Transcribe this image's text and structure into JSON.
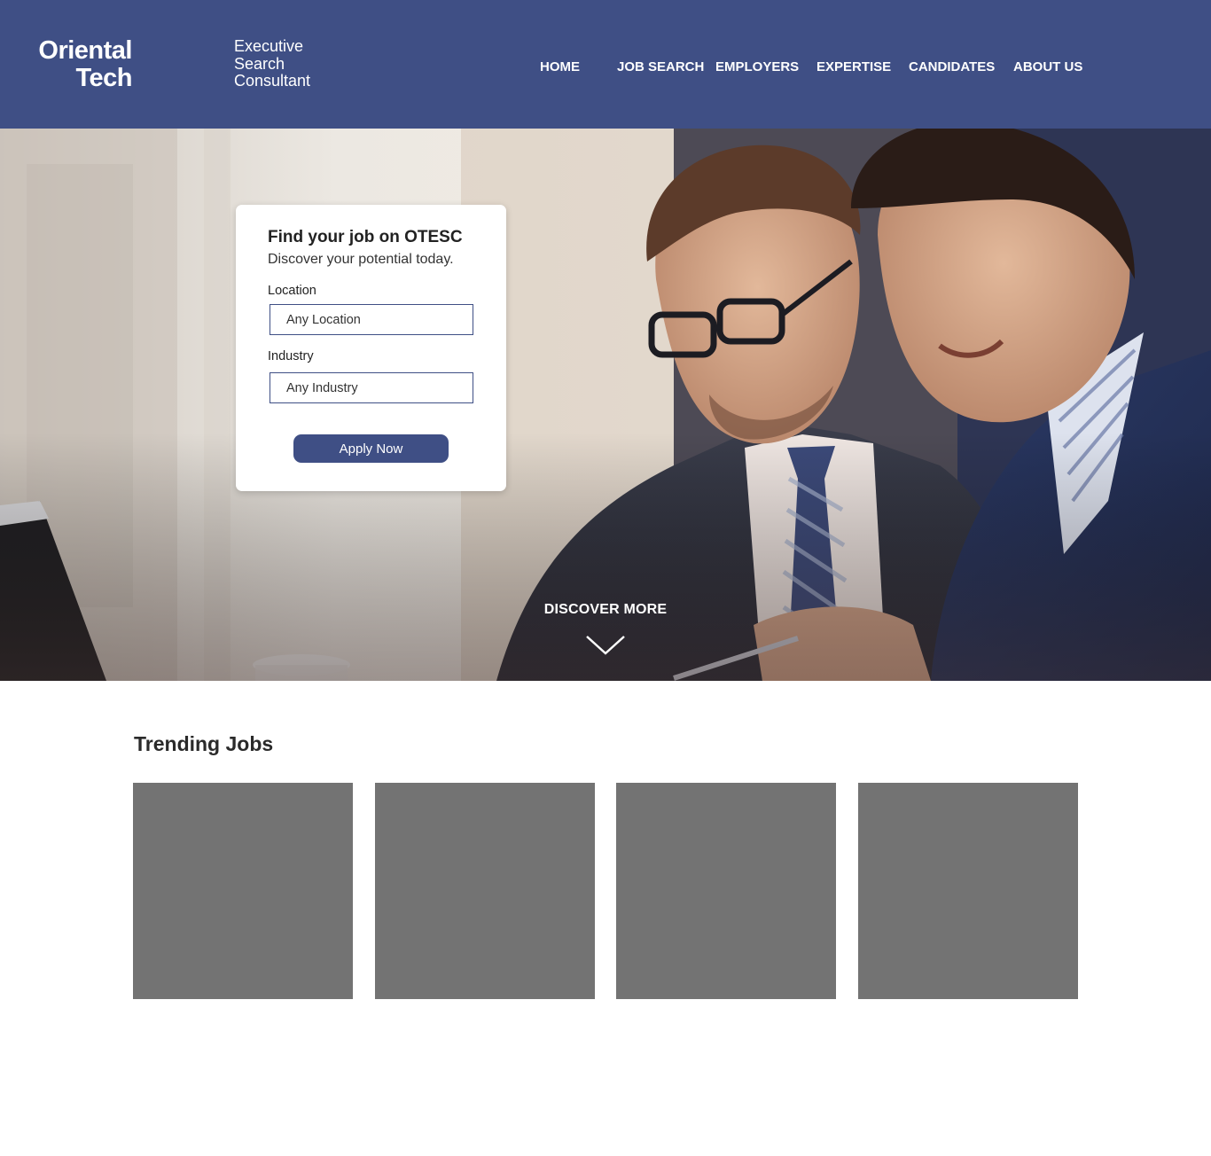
{
  "brand": {
    "name_line1": "Oriental",
    "name_line2": "Tech",
    "tagline": [
      "Executive",
      "Search",
      "Consultant"
    ]
  },
  "nav": {
    "items": [
      {
        "label": "HOME"
      },
      {
        "label": "JOB SEARCH"
      },
      {
        "label": "EMPLOYERS"
      },
      {
        "label": "EXPERTISE"
      },
      {
        "label": "CANDIDATES"
      },
      {
        "label": "ABOUT US"
      }
    ]
  },
  "search": {
    "title": "Find your job on OTESC",
    "subtitle": "Discover your potential today.",
    "location_label": "Location",
    "location_value": "Any Location",
    "industry_label": "Industry",
    "industry_value": "Any Industry",
    "apply_label": "Apply Now"
  },
  "hero": {
    "discover_label": "DISCOVER MORE"
  },
  "trending": {
    "title": "Trending Jobs",
    "jobs": [
      {
        "id": "1"
      },
      {
        "id": "2"
      },
      {
        "id": "3"
      },
      {
        "id": "4"
      }
    ]
  },
  "colors": {
    "brand": "#3f4f85",
    "card_placeholder": "#737373",
    "text_dark": "#222222"
  }
}
